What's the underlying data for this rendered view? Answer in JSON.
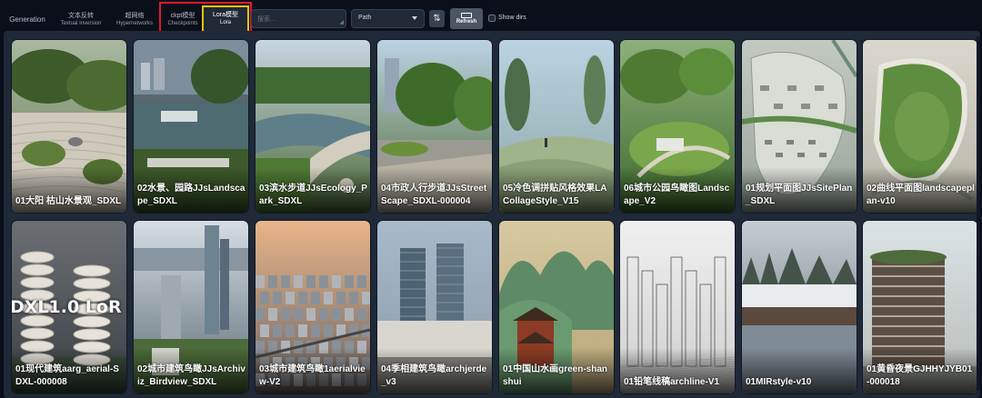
{
  "tabs": [
    {
      "label": "Generation"
    },
    {
      "label": "文本反转",
      "sub": "Textual Inversion"
    },
    {
      "label": "超网络",
      "sub": "Hypernetworks"
    },
    {
      "label": "ckpt模型",
      "sub": "Checkpoints"
    },
    {
      "label": "Lora模型",
      "sub": "Lora"
    }
  ],
  "toolbar": {
    "search_placeholder": "搜索...",
    "sort_select_value": "Path",
    "sort_direction_icon": "⇅",
    "refresh_label": "Refresh",
    "show_dirs_label": "Show dirs"
  },
  "highlight_colors": {
    "outer": "#e0192d",
    "inner": "#f3c400"
  },
  "cards": [
    {
      "label": "01大阳 枯山水景观_SDXL",
      "theme": "zen-garden"
    },
    {
      "label": "02水景、园路JJsLandscape_SDXL",
      "theme": "water-plaza"
    },
    {
      "label": "03滨水步道JJsEcology_Park_SDXL",
      "theme": "river-walk"
    },
    {
      "label": "04市政人行步道JJsStreetScape_SDXL-000004",
      "theme": "street"
    },
    {
      "label": "05冷色调拼贴风格效果LACollageStyle_V15",
      "theme": "collage"
    },
    {
      "label": "06城市公园鸟瞰图Landscape_V2",
      "theme": "park-aerial"
    },
    {
      "label": "01规划平面图JJsSitePlan_SDXL",
      "theme": "site-plan"
    },
    {
      "label": "02曲线平面图landscapeplan-v10",
      "theme": "curve-plan"
    },
    {
      "label": "01现代建筑aarg_aerial-SDXL-000008",
      "theme": "tower",
      "overlay": "DXL1.0  LoR"
    },
    {
      "label": "02城市建筑鸟瞰JJsArchiviz_Birdview_SDXL",
      "theme": "city-birdview"
    },
    {
      "label": "03城市建筑鸟瞰1aerialview-V2",
      "theme": "dense-city"
    },
    {
      "label": "04季相建筑鸟瞰archjerde_v3",
      "theme": "office-towers"
    },
    {
      "label": "01中国山水画green-shanshui",
      "theme": "shanshui"
    },
    {
      "label": "01铅笔线稿archline-V1",
      "theme": "pencil-sketch"
    },
    {
      "label": "01MIRstyle-v10",
      "theme": "mir-lake"
    },
    {
      "label": "01黄昏夜景GJHHYJYB01-000018",
      "theme": "dusk-building"
    }
  ]
}
